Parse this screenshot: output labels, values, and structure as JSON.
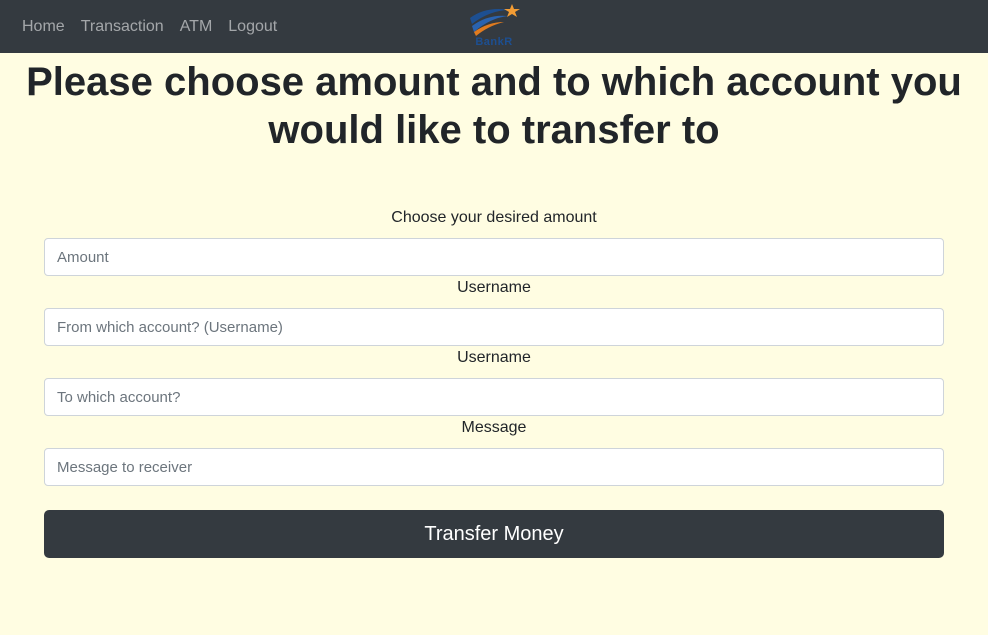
{
  "nav": {
    "links": [
      "Home",
      "Transaction",
      "ATM",
      "Logout"
    ],
    "logo_text": "BankR"
  },
  "page": {
    "heading": "Please choose amount and to which account you would like to transfer to"
  },
  "form": {
    "amount_label": "Choose your desired amount",
    "amount_placeholder": "Amount",
    "from_label": "Username",
    "from_placeholder": "From which account? (Username)",
    "to_label": "Username",
    "to_placeholder": "To which account?",
    "message_label": "Message",
    "message_placeholder": "Message to receiver",
    "submit_label": "Transfer Money"
  },
  "colors": {
    "navbar": "#343a40",
    "background": "#fffde2",
    "button": "#343a40",
    "logo_blue": "#1d4f91",
    "logo_star": "#f39c34"
  }
}
